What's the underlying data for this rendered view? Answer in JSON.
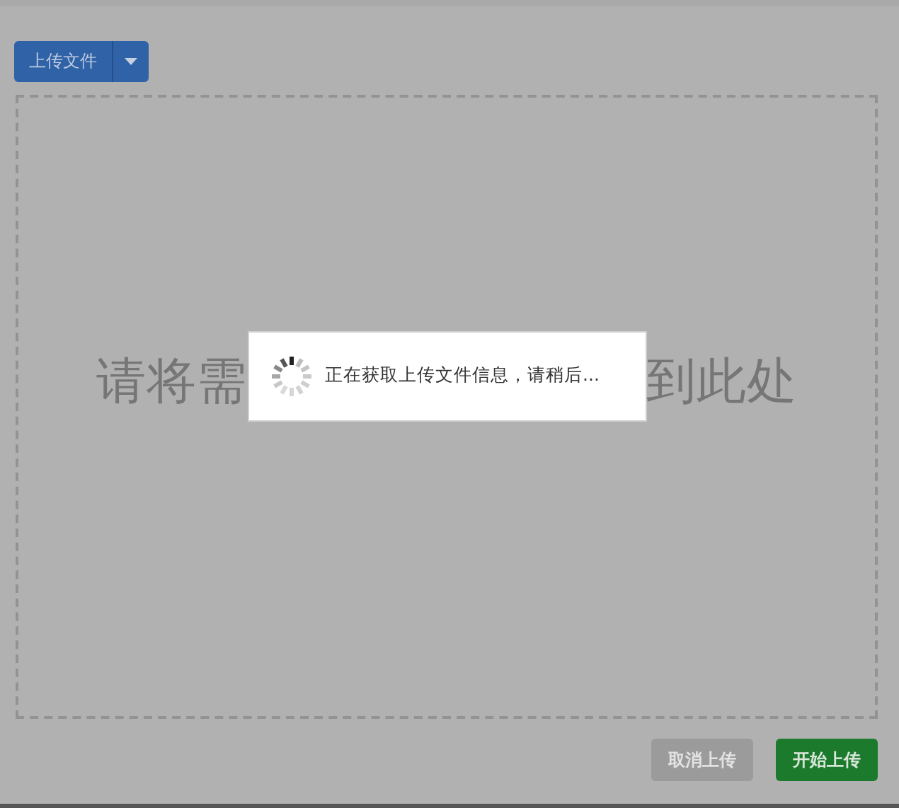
{
  "upload_button": {
    "label": "上传文件"
  },
  "drop_zone": {
    "hint_start": "请将需",
    "hint_end": "到此处"
  },
  "loading_dialog": {
    "message": "正在获取上传文件信息，请稍后..."
  },
  "buttons": [
    {
      "label": "取消上传",
      "kind": "cancel",
      "disabled": true
    },
    {
      "label": "开始上传",
      "kind": "start",
      "disabled": false
    }
  ]
}
